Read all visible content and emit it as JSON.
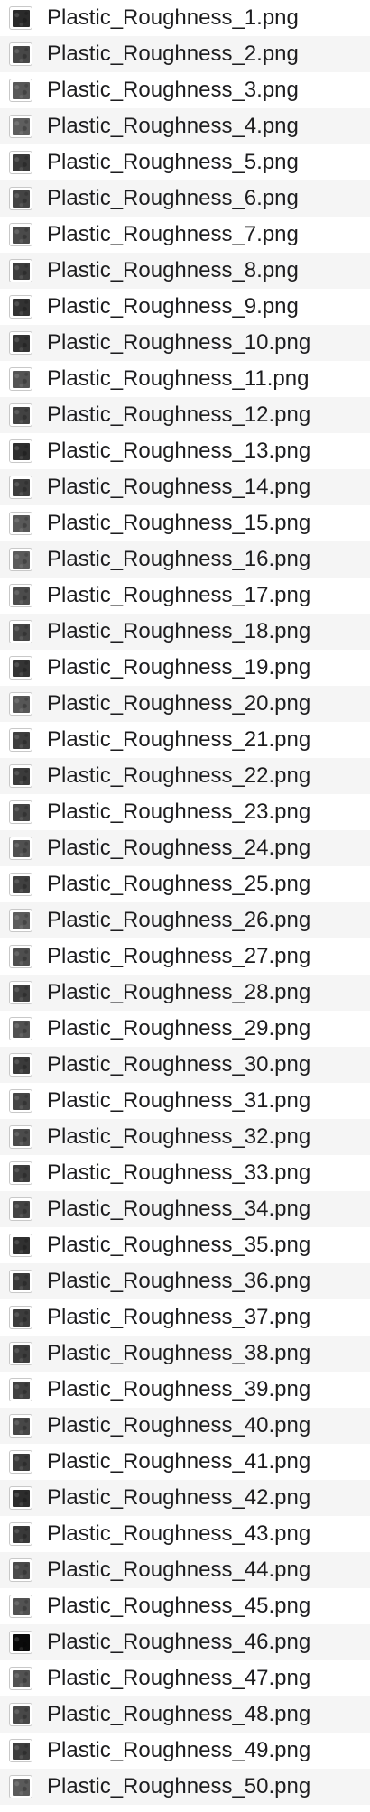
{
  "files": [
    {
      "name": "Plastic_Roughness_1.png",
      "thumb": "#2a2a2a"
    },
    {
      "name": "Plastic_Roughness_2.png",
      "thumb": "#474747"
    },
    {
      "name": "Plastic_Roughness_3.png",
      "thumb": "#585858"
    },
    {
      "name": "Plastic_Roughness_4.png",
      "thumb": "#5e5e5e"
    },
    {
      "name": "Plastic_Roughness_5.png",
      "thumb": "#3a3a3a"
    },
    {
      "name": "Plastic_Roughness_6.png",
      "thumb": "#444444"
    },
    {
      "name": "Plastic_Roughness_7.png",
      "thumb": "#4a4a4a"
    },
    {
      "name": "Plastic_Roughness_8.png",
      "thumb": "#3c3c3c"
    },
    {
      "name": "Plastic_Roughness_9.png",
      "thumb": "#323232"
    },
    {
      "name": "Plastic_Roughness_10.png",
      "thumb": "#333333"
    },
    {
      "name": "Plastic_Roughness_11.png",
      "thumb": "#545454"
    },
    {
      "name": "Plastic_Roughness_12.png",
      "thumb": "#424242"
    },
    {
      "name": "Plastic_Roughness_13.png",
      "thumb": "#2e2e2e"
    },
    {
      "name": "Plastic_Roughness_14.png",
      "thumb": "#3d3d3d"
    },
    {
      "name": "Plastic_Roughness_15.png",
      "thumb": "#585858"
    },
    {
      "name": "Plastic_Roughness_16.png",
      "thumb": "#5a5a5a"
    },
    {
      "name": "Plastic_Roughness_17.png",
      "thumb": "#4c4c4c"
    },
    {
      "name": "Plastic_Roughness_18.png",
      "thumb": "#454545"
    },
    {
      "name": "Plastic_Roughness_19.png",
      "thumb": "#343434"
    },
    {
      "name": "Plastic_Roughness_20.png",
      "thumb": "#565656"
    },
    {
      "name": "Plastic_Roughness_21.png",
      "thumb": "#3e3e3e"
    },
    {
      "name": "Plastic_Roughness_22.png",
      "thumb": "#3b3b3b"
    },
    {
      "name": "Plastic_Roughness_23.png",
      "thumb": "#444444"
    },
    {
      "name": "Plastic_Roughness_24.png",
      "thumb": "#505050"
    },
    {
      "name": "Plastic_Roughness_25.png",
      "thumb": "#404040"
    },
    {
      "name": "Plastic_Roughness_26.png",
      "thumb": "#5c5c5c"
    },
    {
      "name": "Plastic_Roughness_27.png",
      "thumb": "#4e4e4e"
    },
    {
      "name": "Plastic_Roughness_28.png",
      "thumb": "#3f3f3f"
    },
    {
      "name": "Plastic_Roughness_29.png",
      "thumb": "#515151"
    },
    {
      "name": "Plastic_Roughness_30.png",
      "thumb": "#3a3a3a"
    },
    {
      "name": "Plastic_Roughness_31.png",
      "thumb": "#454545"
    },
    {
      "name": "Plastic_Roughness_32.png",
      "thumb": "#4b4b4b"
    },
    {
      "name": "Plastic_Roughness_33.png",
      "thumb": "#3d3d3d"
    },
    {
      "name": "Plastic_Roughness_34.png",
      "thumb": "#444444"
    },
    {
      "name": "Plastic_Roughness_35.png",
      "thumb": "#303030"
    },
    {
      "name": "Plastic_Roughness_36.png",
      "thumb": "#3a3a3a"
    },
    {
      "name": "Plastic_Roughness_37.png",
      "thumb": "#3c3c3c"
    },
    {
      "name": "Plastic_Roughness_38.png",
      "thumb": "#3d3d3d"
    },
    {
      "name": "Plastic_Roughness_39.png",
      "thumb": "#414141"
    },
    {
      "name": "Plastic_Roughness_40.png",
      "thumb": "#474747"
    },
    {
      "name": "Plastic_Roughness_41.png",
      "thumb": "#3b3b3b"
    },
    {
      "name": "Plastic_Roughness_42.png",
      "thumb": "#2c2c2c"
    },
    {
      "name": "Plastic_Roughness_43.png",
      "thumb": "#393939"
    },
    {
      "name": "Plastic_Roughness_44.png",
      "thumb": "#4a4a4a"
    },
    {
      "name": "Plastic_Roughness_45.png",
      "thumb": "#525252"
    },
    {
      "name": "Plastic_Roughness_46.png",
      "thumb": "#0a0a0a"
    },
    {
      "name": "Plastic_Roughness_47.png",
      "thumb": "#525252"
    },
    {
      "name": "Plastic_Roughness_48.png",
      "thumb": "#484848"
    },
    {
      "name": "Plastic_Roughness_49.png",
      "thumb": "#3e3e3e"
    },
    {
      "name": "Plastic_Roughness_50.png",
      "thumb": "#5a5a5a"
    }
  ]
}
